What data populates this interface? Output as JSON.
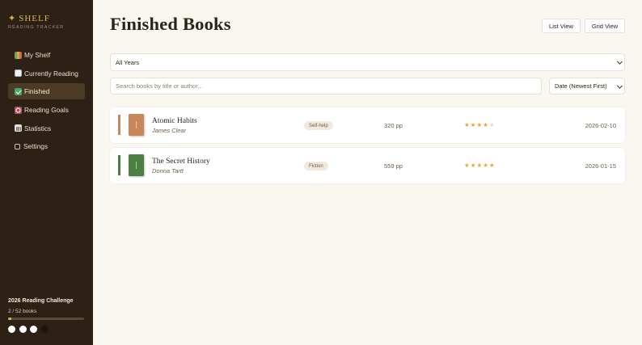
{
  "brand": {
    "name": "SHELF",
    "subtitle": "READING TRACKER"
  },
  "sidebar": {
    "items": [
      {
        "label": "My Shelf",
        "icon": "books-icon",
        "active": false
      },
      {
        "label": "Currently Reading",
        "icon": "open-book-icon",
        "active": false
      },
      {
        "label": "Finished",
        "icon": "check-icon",
        "active": true
      },
      {
        "label": "Reading Goals",
        "icon": "target-icon",
        "active": false
      },
      {
        "label": "Statistics",
        "icon": "bar-chart-icon",
        "active": false
      },
      {
        "label": "Settings",
        "icon": "gear-icon",
        "active": false
      }
    ]
  },
  "challenge": {
    "title": "2026 Reading Challenge",
    "count_text": "2 / 52 books",
    "read": 2,
    "goal": 52
  },
  "theme_dots": [
    {
      "color": "#ffffff"
    },
    {
      "color": "#ffffff"
    },
    {
      "color": "#ffffff"
    },
    {
      "color": "#1d1509"
    }
  ],
  "main": {
    "title": "Finished Books",
    "list_view_label": "List View",
    "grid_view_label": "Grid View",
    "year_filter": "All Years",
    "search_placeholder": "Search books by title or author...",
    "sort": "Date (Newest First)"
  },
  "books": [
    {
      "title": "Atomic Habits",
      "author": "James Clear",
      "genre": "Self-help",
      "pages": "320 pp",
      "rating": 4,
      "max_rating": 5,
      "date": "2026-02-10",
      "accent_color": "#c7875a",
      "cover_color": "#c7875a"
    },
    {
      "title": "The Secret History",
      "author": "Donna Tartt",
      "genre": "Fiction",
      "pages": "559 pp",
      "rating": 5,
      "max_rating": 5,
      "date": "2026-01-15",
      "accent_color": "#4b7a3e",
      "cover_color": "#4e7f42"
    }
  ],
  "colors": {
    "sidebar_bg": "#2c2114",
    "accent_gold": "#d8b25a",
    "star": "#e2a92f",
    "page_bg": "#faf7f1"
  }
}
